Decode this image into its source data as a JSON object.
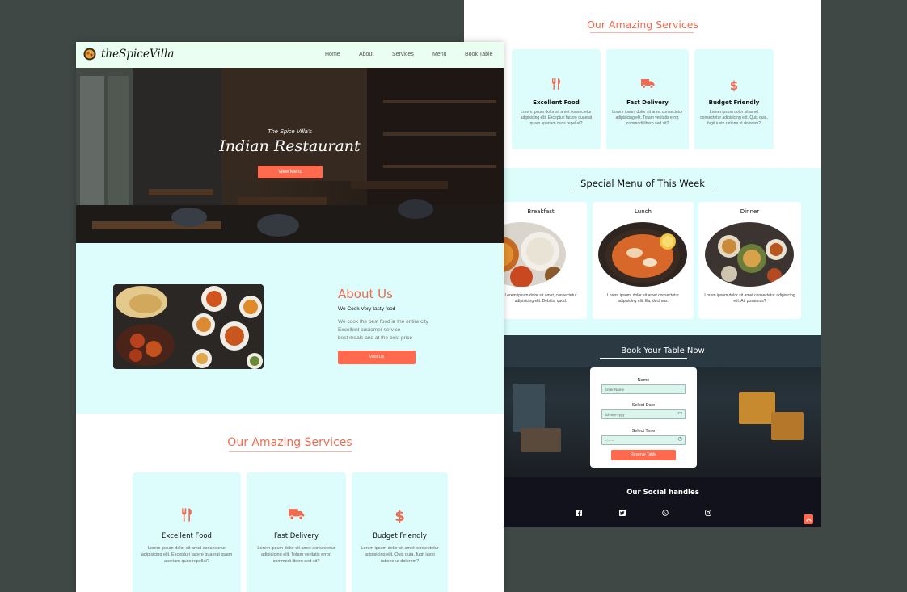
{
  "colors": {
    "accent": "#ff6a4e",
    "accent_text": "#f06b4f",
    "mint": "#dcfdfb",
    "nav_bg": "#eafff2",
    "footer_bg": "#11121c",
    "backdrop": "#3f4845"
  },
  "nav": {
    "brand": "theSpiceVilla",
    "items": [
      "Home",
      "About",
      "Services",
      "Menu",
      "Book Table"
    ]
  },
  "hero": {
    "subtitle": "The Spice Villa's",
    "title": "Indian Restaurant",
    "button": "View Menu"
  },
  "about": {
    "title": "About Us",
    "subtitle": "We Cook Very tasty food",
    "lines": [
      "We cook the best food in the entire city",
      "Excellent customer service",
      "best meals and at the best price"
    ],
    "button": "Visit Us"
  },
  "services": {
    "title": "Our Amazing Services",
    "cards": [
      {
        "icon": "utensils-icon",
        "title": "Excellent Food",
        "text": "Lorem ipsum dolor sit amet consectetur adipisicing elit. Excepturi facere quaerat quam aperiam quos repellat?"
      },
      {
        "icon": "truck-icon",
        "title": "Fast Delivery",
        "text": "Lorem ipsum dolor sit amet consectetur adipisicing elit. Totam veritatis error, commodi libero sed sit?"
      },
      {
        "icon": "dollar-icon",
        "title": "Budget Friendly",
        "text": "Lorem ipsum dolor sit amet consectetur adipisicing elit. Quis quia, fugit iusto ratione ut dolorem?"
      }
    ]
  },
  "menu": {
    "title": "Special Menu of This Week",
    "cards": [
      {
        "name": "Breakfast",
        "text": "Lorem ipsum dolor sit amet, consectetur adipisicing elit. Debitis, quod."
      },
      {
        "name": "Lunch",
        "text": "Lorem ipsum, dolor sit amet consectetur adipisicing elit. Ea, ducimus."
      },
      {
        "name": "Dinner",
        "text": "Lorem ipsum dolor sit amet consectetur adipisicing elit. At, possimus?"
      }
    ]
  },
  "booking": {
    "title": "Book Your Table Now",
    "name_label": "Name",
    "name_placeholder": "Enter Name",
    "date_label": "Select Date",
    "date_value": "dd-mm-yyyy",
    "time_label": "Select Time",
    "time_value": "--:-- --",
    "button": "Reserve Table"
  },
  "footer": {
    "social_title": "Our Social handles",
    "social_icons": [
      "facebook-icon",
      "twitter-icon",
      "whatsapp-icon",
      "instagram-icon"
    ]
  }
}
